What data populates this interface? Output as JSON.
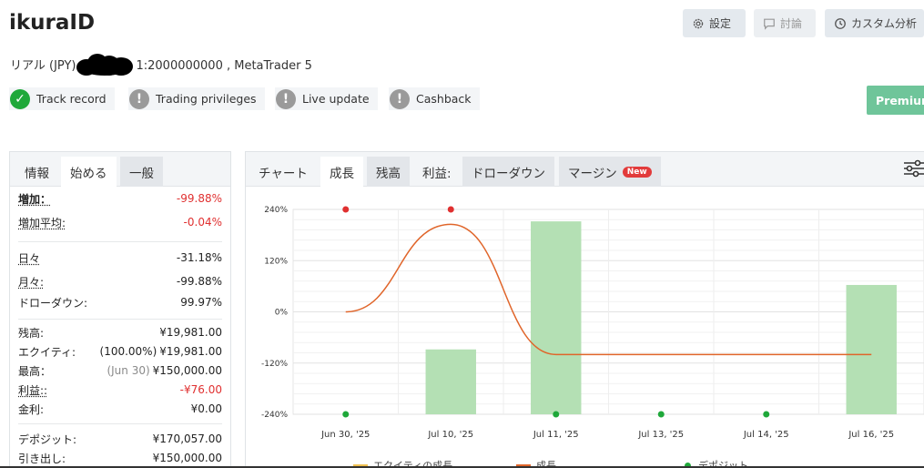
{
  "header": {
    "title": "ikuraID",
    "account_type": "リアル (JPY)",
    "account_info": "1:2000000000 , MetaTrader 5",
    "buttons": [
      {
        "label": "設定",
        "icon": "gear-icon"
      },
      {
        "label": "討論",
        "icon": "chat-icon"
      },
      {
        "label": "カスタム分析",
        "icon": "clock-icon"
      }
    ],
    "premium_label": "Premium"
  },
  "badges": [
    {
      "label": "Track record",
      "status": "ok"
    },
    {
      "label": "Trading privileges",
      "status": "warn"
    },
    {
      "label": "Live update",
      "status": "warn"
    },
    {
      "label": "Cashback",
      "status": "warn"
    }
  ],
  "left_tabs": [
    "情報",
    "始める",
    "一般"
  ],
  "stats": {
    "gain": {
      "label": "増加：",
      "value": "-99.88%"
    },
    "avg_gain": {
      "label": "増加平均:",
      "value": "-0.04%"
    },
    "daily": {
      "label": "日々",
      "value": "-31.18%"
    },
    "monthly": {
      "label": "月々:",
      "value": "-99.88%"
    },
    "drawdown": {
      "label": "ドローダウン:",
      "value": "99.97%"
    },
    "balance": {
      "label": "残高:",
      "value": "¥19,981.00"
    },
    "equity": {
      "label": "エクイティ:",
      "pct": "(100.00%)",
      "value": "¥19,981.00"
    },
    "highest": {
      "label": "最高：",
      "date": "(Jun 30)",
      "value": "¥150,000.00"
    },
    "profit": {
      "label": "利益::",
      "value": "-¥76.00"
    },
    "interest": {
      "label": "金利:",
      "value": "¥0.00"
    },
    "deposits": {
      "label": "デポジット:",
      "value": "¥170,057.00"
    },
    "withdrawals": {
      "label": "引き出し:",
      "value": "¥150,000.00"
    }
  },
  "right_tabs": [
    "チャート",
    "成長",
    "残高",
    "利益:",
    "ドローダウン",
    "マージン"
  ],
  "new_badge": "New",
  "colors": {
    "accent_green": "#1fa83a",
    "loss_red": "#e03030",
    "growth_line": "#e0652a",
    "bar_fill": "#b4e0b4",
    "premium": "#6fc59a"
  },
  "chart_data": {
    "type": "bar",
    "categories": [
      "Jun 30, '25",
      "Jul 10, '25",
      "Jul 11, '25",
      "Jul 13, '25",
      "Jul 14, '25",
      "Jul 16, '25"
    ],
    "ylim": [
      -240,
      240
    ],
    "yticks": [
      "240%",
      "120%",
      "0%",
      "-120%",
      "-240%"
    ],
    "ytick_values": [
      240,
      120,
      0,
      -120,
      -240
    ],
    "grid": true,
    "legend_position": "bottom",
    "series": [
      {
        "name": "エクイティの成長",
        "kind": "line",
        "color": "#f0c050",
        "values": []
      },
      {
        "name": "成長",
        "kind": "line",
        "color": "#e0652a",
        "values": [
          0,
          205,
          -99.88,
          -99.88,
          -99.88,
          -99.88
        ]
      },
      {
        "name": "デポジット",
        "kind": "dots",
        "color": "#1fa83a",
        "values": [
          -240,
          null,
          -240,
          -240,
          -240,
          null
        ]
      },
      {
        "name": "",
        "kind": "bar",
        "color": "#b4e0b4",
        "values": [
          null,
          -88,
          212,
          null,
          null,
          63
        ]
      },
      {
        "name": "",
        "kind": "dots",
        "color": "#e03030",
        "values": [
          240,
          240,
          null,
          null,
          null,
          null
        ]
      }
    ]
  }
}
